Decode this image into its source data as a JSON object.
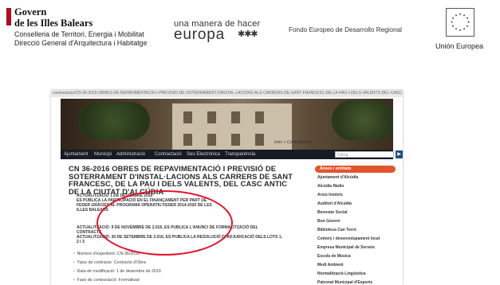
{
  "header": {
    "govern_name_line1": "Govern",
    "govern_name_line2": "de les Illes Balears",
    "govern_sub_line1": "Conselleria de Territori, Energia i Mobilitat",
    "govern_sub_line2": "Direcció General d'Arquitectura i Habitatge",
    "europa_tagline": "una manera de hacer",
    "europa_word": "europa",
    "europa_stars": "✱✱✱",
    "fondo": "Fondo Europeo de Desarrollo Regional",
    "eu_stars": "★ ★ ★",
    "eu_label": "Unión Europea"
  },
  "screenshot": {
    "url": "contractacio/CN-36-2016-OBRES-DE-REPAVIMENTACIO-I-PREVISIO-DE-SOTERRAMENT-DINSTAL-LACIONS-ALS-CARRERS-DE-SANT-FRANCESC-DE-LA-PAU-I-DELS-VALENTS-DEL-CASC-ANTIC",
    "nav": [
      "Ajuntament",
      "Municipi",
      "Administració",
      "Contractació",
      "Seu Electrònica",
      "Transparència"
    ],
    "search_placeholder": "Cerca:",
    "breadcrumb_home": "Inici",
    "breadcrumb_sep": "»",
    "breadcrumb_current": "Contractació",
    "title": "CN 36-2016 OBRES DE REPAVIMENTACIÓ I PREVISIÓ DE SOTERRAMENT D'INSTAL·LACIONS ALS CARRERS DE SANT FRANCESC, DE LA PAU I DELS VALENTS, DEL CASC ANTIC DE LA CIUTAT D'ALCÚDIA",
    "update1_line1": "ACTUALITZACIÓ 1 DE DESEMBRE 2016",
    "update1_line2": "ES PUBLICA LA PARTICIPACIÓ EN EL FINANÇAMENT PER PART DE FEDER GRÀCIES AL PROGRAMA OPERATIU FEDER 2014-2020 DE LES ILLES BALEARS",
    "update2_line1": "ACTUALITZACIÓ: 9 DE NOVEMBRE DE 2.016, ES PUBLICA L'ANUNCI DE FORMALITZACIÓ DEL CONTRACTE",
    "update2_line2": "ACTUALITZACIÓ: 30 DE SETEMBRE DE 2.016, ES PUBLICA LA RESOLUCIÓ D' ADJUDICACIÓ DELS LOTS 1, 2 I 3",
    "meta": [
      "Número d'expedient: CN-36/2016",
      "Tipus de contracte: Contracte d'Obra",
      "Data de modificació: 1 de desembre de 2016",
      "Fase de contractació: Formalitzat"
    ],
    "side_head": "Àrees i entitats",
    "side_items": [
      "Ajuntament d'Alcúdia",
      "Alcúdia Ràdio",
      "Arxiu històric",
      "Auditori d'Alcúdia",
      "Benestar Social",
      "Bon Govern",
      "Biblioteca Can Torró",
      "Comerç i desenvolupament local",
      "Empresa Municipal de Serveis",
      "Escola de Música",
      "Medi Ambient",
      "Normalització Lingüística",
      "Patronat Municipal d'Esports"
    ]
  }
}
